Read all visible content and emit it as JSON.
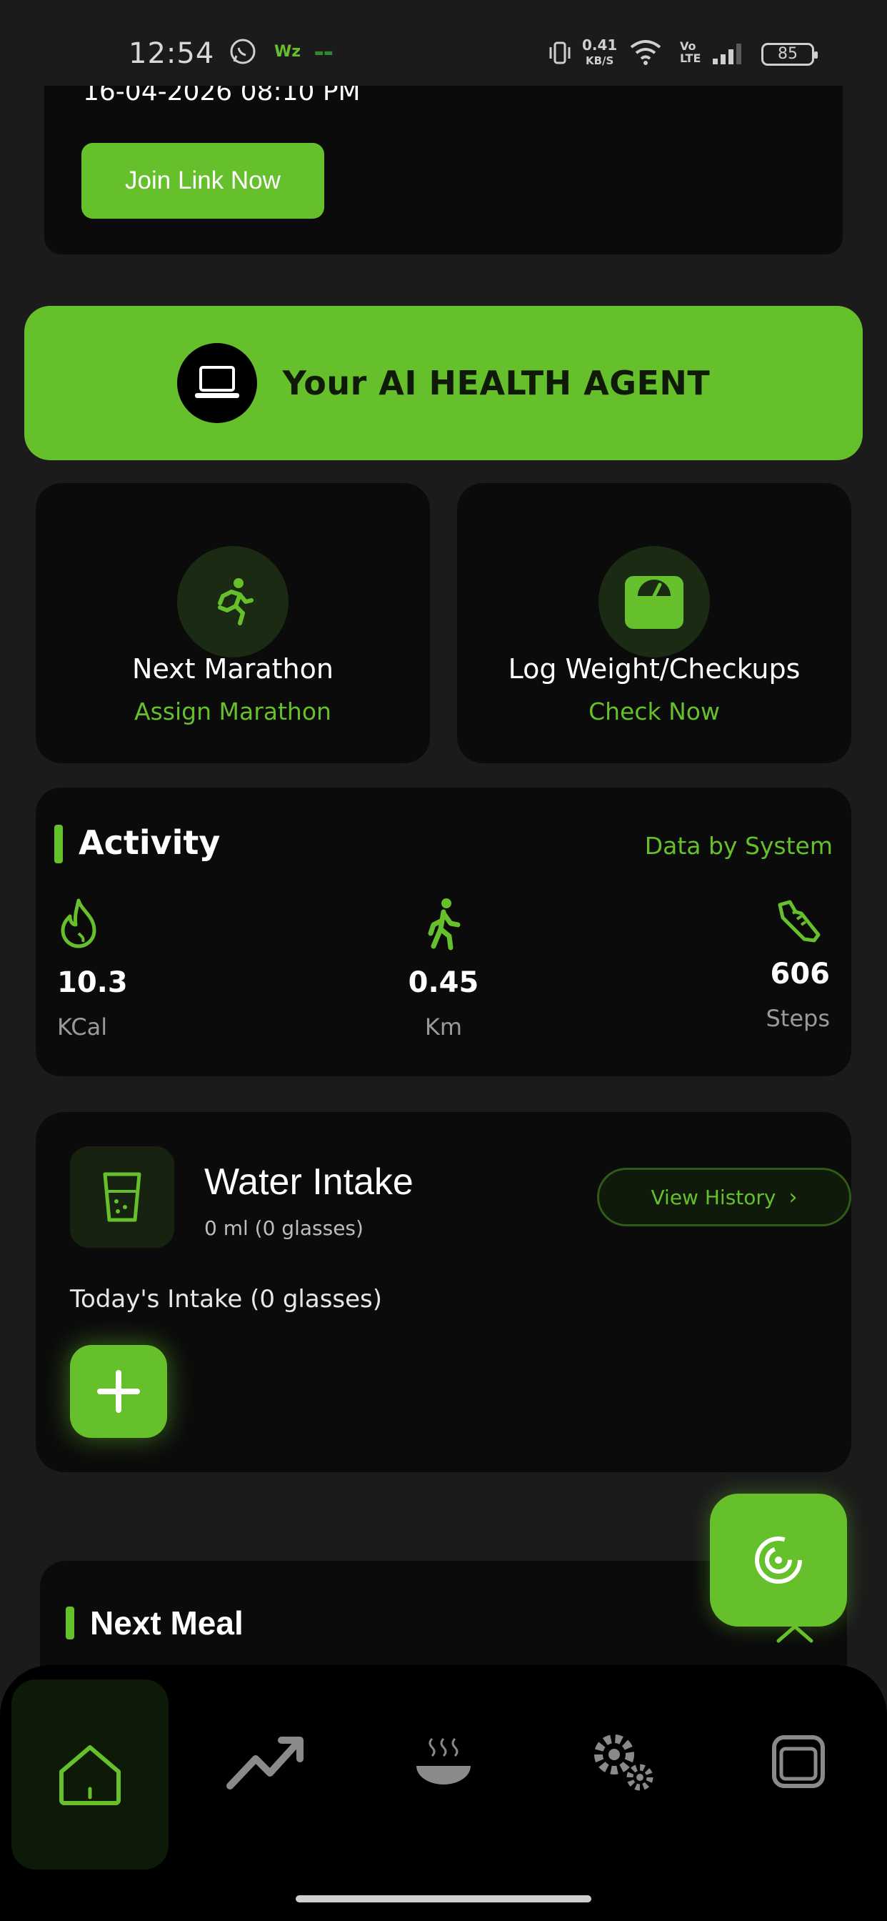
{
  "status_bar": {
    "time": "12:54",
    "net_speed": "0.41",
    "net_unit": "KB/S",
    "battery": "85",
    "icons": [
      "whatsapp-icon",
      "vibrate-icon",
      "wifi-icon",
      "volte-icon",
      "signal-icon"
    ]
  },
  "meeting": {
    "datetime": "16-04-2026 08:10 PM",
    "join_label": "Join Link Now"
  },
  "ai_banner": {
    "label": "Your AI HEALTH AGENT",
    "icon": "laptop-icon"
  },
  "cards": [
    {
      "title": "Next Marathon",
      "link": "Assign Marathon",
      "icon": "runner-icon"
    },
    {
      "title": "Log Weight/Checkups",
      "link": "Check Now",
      "icon": "scale-icon"
    }
  ],
  "activity": {
    "title": "Activity",
    "source": "Data by System",
    "metrics": [
      {
        "value": "10.3",
        "unit": "KCal",
        "icon": "flame-icon"
      },
      {
        "value": "0.45",
        "unit": "Km",
        "icon": "walking-icon"
      },
      {
        "value": "606",
        "unit": "Steps",
        "icon": "shoe-icon"
      }
    ]
  },
  "water": {
    "title": "Water Intake",
    "subtitle": "0 ml (0 glasses)",
    "history_label": "View History",
    "today_label": "Today's Intake (0 glasses)"
  },
  "next_meal": {
    "title": "Next Meal"
  },
  "nav": {
    "items": [
      "home-icon",
      "trending-up-icon",
      "meal-bowl-icon",
      "settings-gears-icon",
      "window-icon"
    ],
    "active": "home"
  },
  "colors": {
    "accent": "#66c02b",
    "background": "#1b1b1b",
    "card": "#0b0b0b"
  }
}
